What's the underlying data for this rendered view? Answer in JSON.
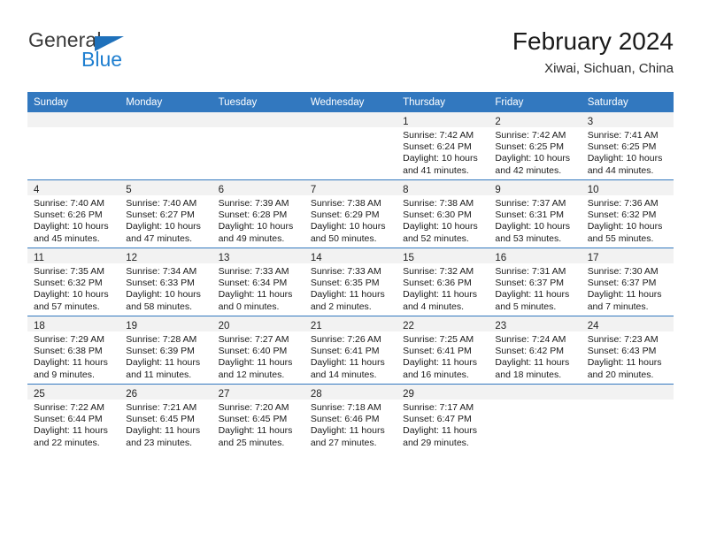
{
  "brand": {
    "name_top": "General",
    "name_bottom": "Blue",
    "accent_color": "#1f7fd0",
    "triangle_color": "#1f71bb"
  },
  "header": {
    "title": "February 2024",
    "subtitle": "Xiwai, Sichuan, China"
  },
  "calendar": {
    "header_bg": "#3278bf",
    "header_text_color": "#ffffff",
    "daynum_band_bg": "#f2f2f2",
    "weekday_headers": [
      "Sunday",
      "Monday",
      "Tuesday",
      "Wednesday",
      "Thursday",
      "Friday",
      "Saturday"
    ],
    "weeks": [
      [
        {
          "day": ""
        },
        {
          "day": ""
        },
        {
          "day": ""
        },
        {
          "day": ""
        },
        {
          "day": "1",
          "sunrise": "Sunrise: 7:42 AM",
          "sunset": "Sunset: 6:24 PM",
          "daylight_line1": "Daylight: 10 hours",
          "daylight_line2": "and 41 minutes."
        },
        {
          "day": "2",
          "sunrise": "Sunrise: 7:42 AM",
          "sunset": "Sunset: 6:25 PM",
          "daylight_line1": "Daylight: 10 hours",
          "daylight_line2": "and 42 minutes."
        },
        {
          "day": "3",
          "sunrise": "Sunrise: 7:41 AM",
          "sunset": "Sunset: 6:25 PM",
          "daylight_line1": "Daylight: 10 hours",
          "daylight_line2": "and 44 minutes."
        }
      ],
      [
        {
          "day": "4",
          "sunrise": "Sunrise: 7:40 AM",
          "sunset": "Sunset: 6:26 PM",
          "daylight_line1": "Daylight: 10 hours",
          "daylight_line2": "and 45 minutes."
        },
        {
          "day": "5",
          "sunrise": "Sunrise: 7:40 AM",
          "sunset": "Sunset: 6:27 PM",
          "daylight_line1": "Daylight: 10 hours",
          "daylight_line2": "and 47 minutes."
        },
        {
          "day": "6",
          "sunrise": "Sunrise: 7:39 AM",
          "sunset": "Sunset: 6:28 PM",
          "daylight_line1": "Daylight: 10 hours",
          "daylight_line2": "and 49 minutes."
        },
        {
          "day": "7",
          "sunrise": "Sunrise: 7:38 AM",
          "sunset": "Sunset: 6:29 PM",
          "daylight_line1": "Daylight: 10 hours",
          "daylight_line2": "and 50 minutes."
        },
        {
          "day": "8",
          "sunrise": "Sunrise: 7:38 AM",
          "sunset": "Sunset: 6:30 PM",
          "daylight_line1": "Daylight: 10 hours",
          "daylight_line2": "and 52 minutes."
        },
        {
          "day": "9",
          "sunrise": "Sunrise: 7:37 AM",
          "sunset": "Sunset: 6:31 PM",
          "daylight_line1": "Daylight: 10 hours",
          "daylight_line2": "and 53 minutes."
        },
        {
          "day": "10",
          "sunrise": "Sunrise: 7:36 AM",
          "sunset": "Sunset: 6:32 PM",
          "daylight_line1": "Daylight: 10 hours",
          "daylight_line2": "and 55 minutes."
        }
      ],
      [
        {
          "day": "11",
          "sunrise": "Sunrise: 7:35 AM",
          "sunset": "Sunset: 6:32 PM",
          "daylight_line1": "Daylight: 10 hours",
          "daylight_line2": "and 57 minutes."
        },
        {
          "day": "12",
          "sunrise": "Sunrise: 7:34 AM",
          "sunset": "Sunset: 6:33 PM",
          "daylight_line1": "Daylight: 10 hours",
          "daylight_line2": "and 58 minutes."
        },
        {
          "day": "13",
          "sunrise": "Sunrise: 7:33 AM",
          "sunset": "Sunset: 6:34 PM",
          "daylight_line1": "Daylight: 11 hours",
          "daylight_line2": "and 0 minutes."
        },
        {
          "day": "14",
          "sunrise": "Sunrise: 7:33 AM",
          "sunset": "Sunset: 6:35 PM",
          "daylight_line1": "Daylight: 11 hours",
          "daylight_line2": "and 2 minutes."
        },
        {
          "day": "15",
          "sunrise": "Sunrise: 7:32 AM",
          "sunset": "Sunset: 6:36 PM",
          "daylight_line1": "Daylight: 11 hours",
          "daylight_line2": "and 4 minutes."
        },
        {
          "day": "16",
          "sunrise": "Sunrise: 7:31 AM",
          "sunset": "Sunset: 6:37 PM",
          "daylight_line1": "Daylight: 11 hours",
          "daylight_line2": "and 5 minutes."
        },
        {
          "day": "17",
          "sunrise": "Sunrise: 7:30 AM",
          "sunset": "Sunset: 6:37 PM",
          "daylight_line1": "Daylight: 11 hours",
          "daylight_line2": "and 7 minutes."
        }
      ],
      [
        {
          "day": "18",
          "sunrise": "Sunrise: 7:29 AM",
          "sunset": "Sunset: 6:38 PM",
          "daylight_line1": "Daylight: 11 hours",
          "daylight_line2": "and 9 minutes."
        },
        {
          "day": "19",
          "sunrise": "Sunrise: 7:28 AM",
          "sunset": "Sunset: 6:39 PM",
          "daylight_line1": "Daylight: 11 hours",
          "daylight_line2": "and 11 minutes."
        },
        {
          "day": "20",
          "sunrise": "Sunrise: 7:27 AM",
          "sunset": "Sunset: 6:40 PM",
          "daylight_line1": "Daylight: 11 hours",
          "daylight_line2": "and 12 minutes."
        },
        {
          "day": "21",
          "sunrise": "Sunrise: 7:26 AM",
          "sunset": "Sunset: 6:41 PM",
          "daylight_line1": "Daylight: 11 hours",
          "daylight_line2": "and 14 minutes."
        },
        {
          "day": "22",
          "sunrise": "Sunrise: 7:25 AM",
          "sunset": "Sunset: 6:41 PM",
          "daylight_line1": "Daylight: 11 hours",
          "daylight_line2": "and 16 minutes."
        },
        {
          "day": "23",
          "sunrise": "Sunrise: 7:24 AM",
          "sunset": "Sunset: 6:42 PM",
          "daylight_line1": "Daylight: 11 hours",
          "daylight_line2": "and 18 minutes."
        },
        {
          "day": "24",
          "sunrise": "Sunrise: 7:23 AM",
          "sunset": "Sunset: 6:43 PM",
          "daylight_line1": "Daylight: 11 hours",
          "daylight_line2": "and 20 minutes."
        }
      ],
      [
        {
          "day": "25",
          "sunrise": "Sunrise: 7:22 AM",
          "sunset": "Sunset: 6:44 PM",
          "daylight_line1": "Daylight: 11 hours",
          "daylight_line2": "and 22 minutes."
        },
        {
          "day": "26",
          "sunrise": "Sunrise: 7:21 AM",
          "sunset": "Sunset: 6:45 PM",
          "daylight_line1": "Daylight: 11 hours",
          "daylight_line2": "and 23 minutes."
        },
        {
          "day": "27",
          "sunrise": "Sunrise: 7:20 AM",
          "sunset": "Sunset: 6:45 PM",
          "daylight_line1": "Daylight: 11 hours",
          "daylight_line2": "and 25 minutes."
        },
        {
          "day": "28",
          "sunrise": "Sunrise: 7:18 AM",
          "sunset": "Sunset: 6:46 PM",
          "daylight_line1": "Daylight: 11 hours",
          "daylight_line2": "and 27 minutes."
        },
        {
          "day": "29",
          "sunrise": "Sunrise: 7:17 AM",
          "sunset": "Sunset: 6:47 PM",
          "daylight_line1": "Daylight: 11 hours",
          "daylight_line2": "and 29 minutes."
        },
        {
          "day": ""
        },
        {
          "day": ""
        }
      ]
    ]
  }
}
